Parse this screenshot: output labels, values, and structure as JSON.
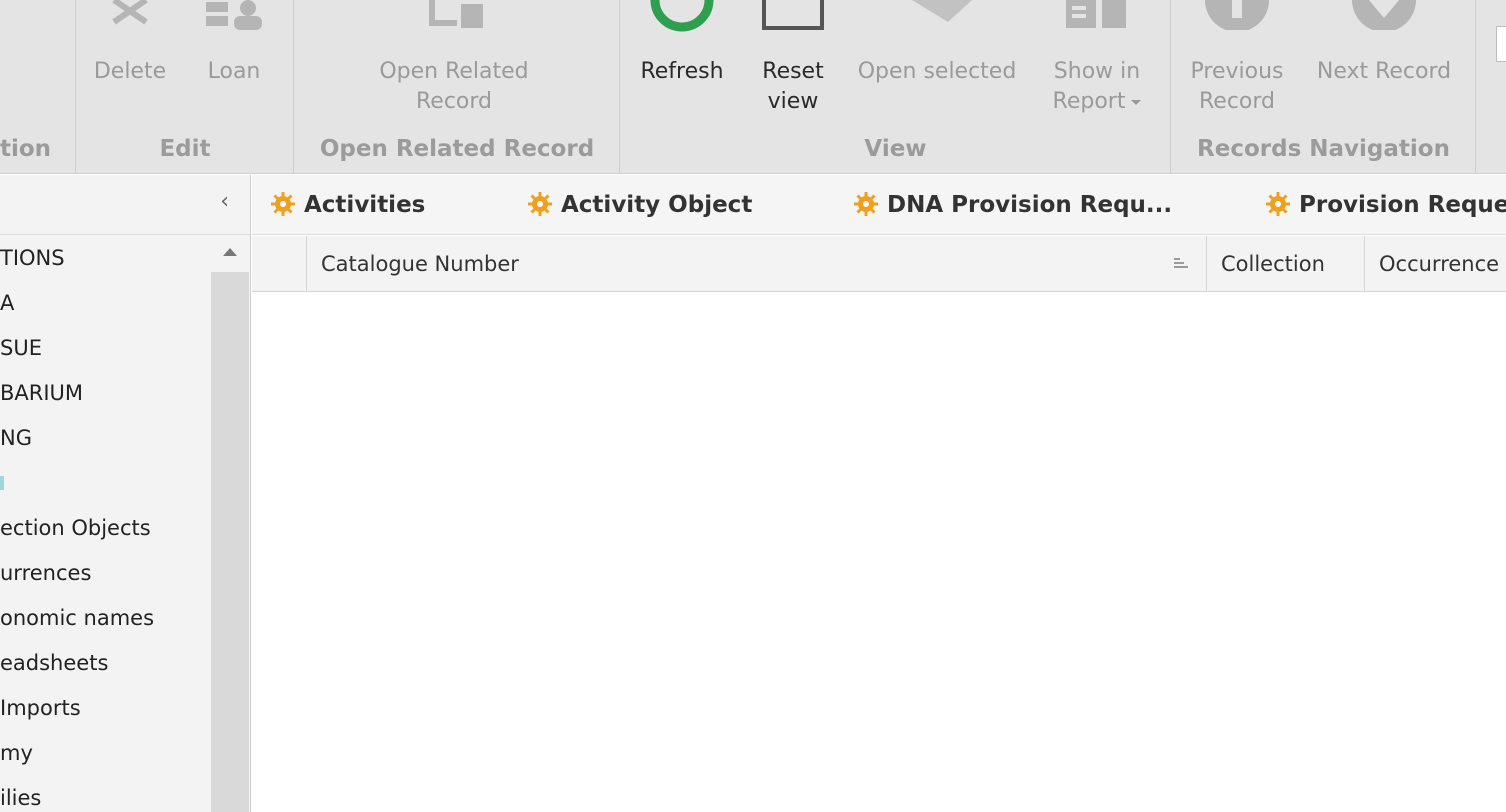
{
  "ribbon": {
    "groups": {
      "partial": {
        "label": "tion"
      },
      "edit": {
        "label": "Edit",
        "delete": "Delete",
        "loan": "Loan"
      },
      "related": {
        "label": "Open Related Record",
        "open_line1": "Open Related",
        "open_line2": "Record"
      },
      "view": {
        "label": "View",
        "refresh": "Refresh",
        "reset_line1": "Reset",
        "reset_line2": "view",
        "open_selected": "Open selected",
        "show_line1": "Show in",
        "show_line2": "Report"
      },
      "nav": {
        "label": "Records Navigation",
        "prev_line1": "Previous",
        "prev_line2": "Record",
        "next": "Next Record"
      }
    },
    "colors": {
      "refresh_green": "#2e9e4f",
      "disabled_gray": "#9a9a9a"
    }
  },
  "nav_pane": {
    "items": [
      {
        "label": "TIONS"
      },
      {
        "label": "A"
      },
      {
        "label": "SUE"
      },
      {
        "label": "BARIUM"
      },
      {
        "label": "NG"
      },
      {
        "label": ""
      },
      {
        "label": "ection Objects"
      },
      {
        "label": "urrences"
      },
      {
        "label": "onomic names"
      },
      {
        "label": "eadsheets"
      },
      {
        "label": "Imports"
      },
      {
        "label": "my"
      },
      {
        "label": "ilies"
      }
    ]
  },
  "tabs": [
    {
      "label": "Activities"
    },
    {
      "label": "Activity Object"
    },
    {
      "label": "DNA Provision Requ..."
    },
    {
      "label": "Provision Reque"
    }
  ],
  "grid": {
    "columns": [
      {
        "label": ""
      },
      {
        "label": "Catalogue Number"
      },
      {
        "label": "Collection"
      },
      {
        "label": "Occurrence"
      }
    ]
  },
  "accent": {
    "tab_icon": "#f0a020"
  }
}
